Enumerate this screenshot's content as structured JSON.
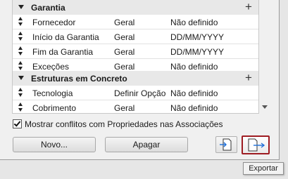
{
  "properties": {
    "groups": [
      {
        "label": "Garantia",
        "items": [
          {
            "name": "Fornecedor",
            "type": "Geral",
            "value": "Não definido"
          },
          {
            "name": "Início da Garantia",
            "type": "Geral",
            "value": "DD/MM/YYYY"
          },
          {
            "name": "Fim da Garantia",
            "type": "Geral",
            "value": "DD/MM/YYYY"
          },
          {
            "name": "Exceções",
            "type": "Geral",
            "value": "Não definido"
          }
        ]
      },
      {
        "label": "Estruturas em Concreto",
        "items": [
          {
            "name": "Tecnologia",
            "type": "Definir Opção",
            "value": "Não definido"
          },
          {
            "name": "Cobrimento",
            "type": "Geral",
            "value": "Não definido"
          }
        ]
      }
    ]
  },
  "checkbox": {
    "label": "Mostrar conflitos com Propriedades nas Associações",
    "checked": true
  },
  "buttons": {
    "new_label": "Novo...",
    "delete_label": "Apagar"
  },
  "tooltip": {
    "text": "Exportar"
  },
  "colors": {
    "highlight_border": "#9e1c22",
    "group_row": "#e8e8e8"
  },
  "icons": {
    "import": "import-icon",
    "export": "export-icon",
    "add": "plus-icon"
  }
}
